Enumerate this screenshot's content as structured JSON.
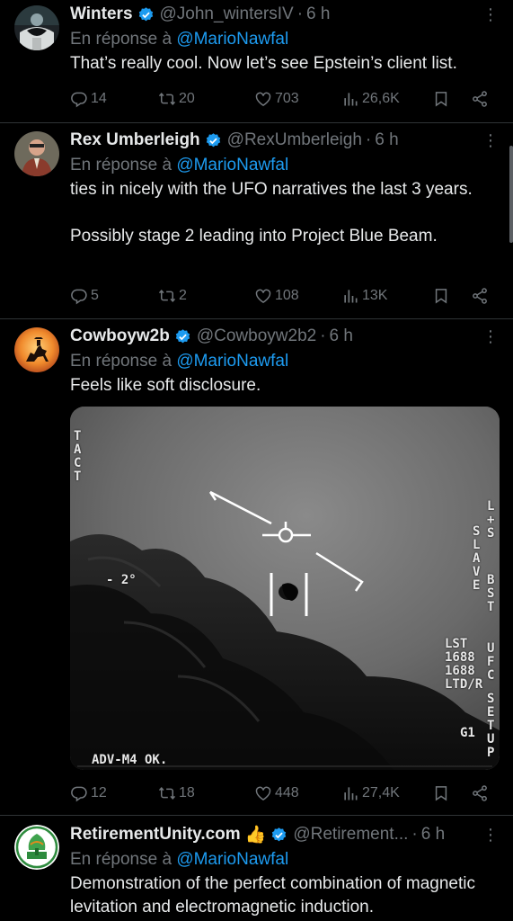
{
  "reply_prefix": "En réponse à",
  "more_glyph": "⋮",
  "colors": {
    "background": "#000000",
    "text": "#e7e9ea",
    "muted": "#71767b",
    "link": "#1d9bf0",
    "verified": "#1d9bf0",
    "divider": "#2f3336"
  },
  "tweets": [
    {
      "name": "Winters",
      "handle": "@John_wintersIV",
      "time": "6 h",
      "reply_to": "@MarioNawfal",
      "text": "That’s really cool. Now let’s see Epstein’s client list.",
      "replies": "14",
      "retweets": "20",
      "likes": "703",
      "views": "26,6K"
    },
    {
      "name": "Rex Umberleigh",
      "handle": "@RexUmberleigh",
      "time": "6 h",
      "reply_to": "@MarioNawfal",
      "text": "ties in nicely with the UFO narratives the last 3 years.\n\nPossibly stage 2 leading into Project Blue Beam.",
      "replies": "5",
      "retweets": "2",
      "likes": "108",
      "views": "13K"
    },
    {
      "name": "Cowboyw2b",
      "handle": "@Cowboyw2b2",
      "time": "6 h",
      "reply_to": "@MarioNawfal",
      "text": "Feels like soft disclosure.",
      "replies": "12",
      "retweets": "18",
      "likes": "448",
      "views": "27,4K",
      "media_overlay": {
        "tact": "TACT",
        "angle": "- 2°",
        "slave": "SLAVE",
        "ls": "L+S",
        "bst": "BST",
        "lst_lines": [
          "LST",
          "1688",
          "1688",
          "LTD/R"
        ],
        "ufc": "UFC",
        "setup": "SETUP",
        "g1": "G1",
        "adv": "ADV-M4 OK."
      }
    },
    {
      "name": "RetirementUnity.com",
      "emoji": "👍",
      "handle": "@Retirement...",
      "time": "6 h",
      "reply_to": "@MarioNawfal",
      "text": "Demonstration of the perfect combination of magnetic levitation and electromagnetic induction."
    }
  ]
}
